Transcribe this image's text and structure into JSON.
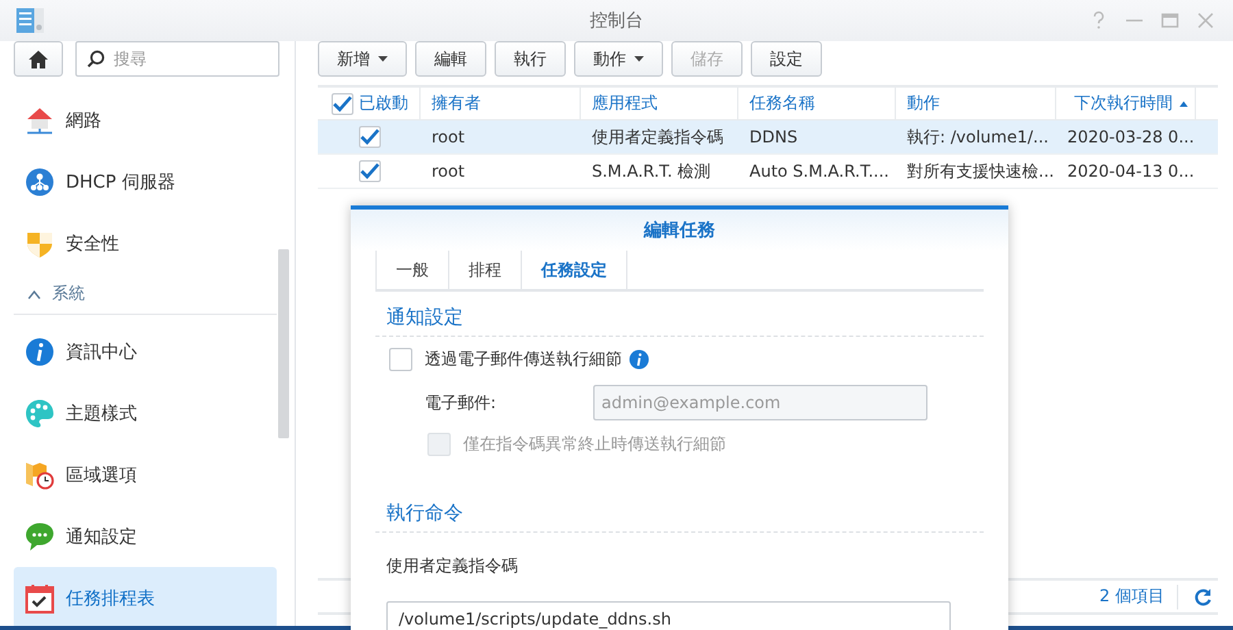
{
  "window": {
    "title": "控制台"
  },
  "search": {
    "placeholder": "搜尋"
  },
  "sidebar": {
    "items": [
      {
        "kind": "item",
        "label": "網路",
        "selected": false
      },
      {
        "kind": "item",
        "label": "DHCP 伺服器",
        "selected": false
      },
      {
        "kind": "item",
        "label": "安全性",
        "selected": false
      },
      {
        "kind": "section",
        "label": "系統",
        "expanded": true
      },
      {
        "kind": "item",
        "label": "資訊中心",
        "selected": false
      },
      {
        "kind": "item",
        "label": "主題樣式",
        "selected": false
      },
      {
        "kind": "item",
        "label": "區域選項",
        "selected": false
      },
      {
        "kind": "item",
        "label": "通知設定",
        "selected": false
      },
      {
        "kind": "item",
        "label": "任務排程表",
        "selected": true
      }
    ]
  },
  "toolbar": [
    {
      "label": "新增",
      "dropdown": true,
      "disabled": false
    },
    {
      "label": "編輯",
      "dropdown": false,
      "disabled": false
    },
    {
      "label": "執行",
      "dropdown": false,
      "disabled": false
    },
    {
      "label": "動作",
      "dropdown": true,
      "disabled": false
    },
    {
      "label": "儲存",
      "dropdown": false,
      "disabled": true
    },
    {
      "label": "設定",
      "dropdown": false,
      "disabled": false
    }
  ],
  "table": {
    "header_checkbox": {
      "checked": true
    },
    "columns": [
      {
        "label": "已啟動",
        "sorted": false
      },
      {
        "label": "擁有者",
        "sorted": false
      },
      {
        "label": "應用程式",
        "sorted": false
      },
      {
        "label": "任務名稱",
        "sorted": false
      },
      {
        "label": "動作",
        "sorted": false
      },
      {
        "label": "下次執行時間",
        "sorted": true
      }
    ],
    "rows": [
      {
        "selected": true,
        "cells": [
          {
            "kind": "checkbox",
            "checked": true
          },
          {
            "kind": "text",
            "text": "root"
          },
          {
            "kind": "text",
            "text": "使用者定義指令碼"
          },
          {
            "kind": "text",
            "text": "DDNS"
          },
          {
            "kind": "text",
            "text": "執行: /volume1/..."
          },
          {
            "kind": "text",
            "text": "2020-03-28 0..."
          }
        ]
      },
      {
        "selected": false,
        "cells": [
          {
            "kind": "checkbox",
            "checked": true
          },
          {
            "kind": "text",
            "text": "root"
          },
          {
            "kind": "text",
            "text": "S.M.A.R.T. 檢測"
          },
          {
            "kind": "text",
            "text": "Auto S.M.A.R.T...."
          },
          {
            "kind": "text",
            "text": "對所有支援快速檢..."
          },
          {
            "kind": "text",
            "text": "2020-04-13 0..."
          }
        ]
      }
    ]
  },
  "status_bar": {
    "count": "2 個項目"
  },
  "dialog": {
    "title": "編輯任務",
    "tabs": [
      {
        "label": "一般",
        "selected": false
      },
      {
        "label": "排程",
        "selected": false
      },
      {
        "label": "任務設定",
        "selected": true
      }
    ],
    "notification": {
      "heading": "通知設定",
      "email_checkbox": {
        "label": "透過電子郵件傳送執行細節",
        "checked": false
      },
      "email_field": {
        "label": "電子郵件:",
        "placeholder": "admin@example.com"
      },
      "abnormal_checkbox": {
        "label": "僅在指令碼異常終止時傳送執行細節",
        "checked": false,
        "disabled": true
      }
    },
    "command": {
      "heading": "執行命令",
      "label": "使用者定義指令碼",
      "value": "/volume1/scripts/update_ddns.sh"
    }
  }
}
